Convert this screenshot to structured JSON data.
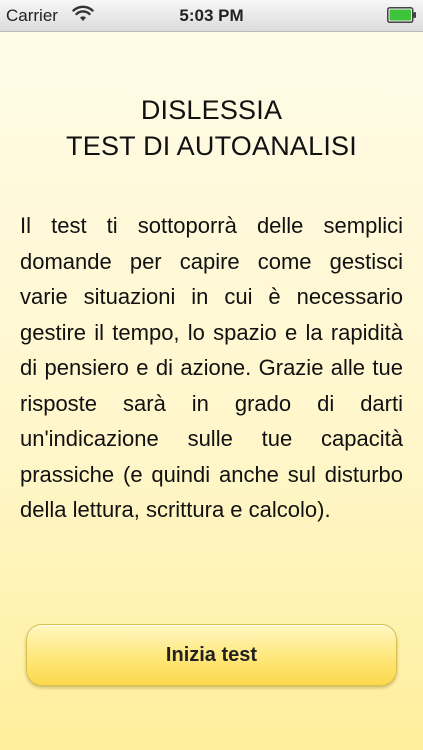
{
  "status_bar": {
    "carrier": "Carrier",
    "time": "5:03 PM",
    "wifi_icon": "wifi-icon",
    "battery_icon": "battery-icon",
    "battery_color": "#3ec43b"
  },
  "main": {
    "title_line1": "DISLESSIA",
    "title_line2": "TEST DI AUTOANALISI",
    "description": "Il test ti sottoporrà delle semplici domande per capire come gestisci varie situazioni in cui è necessario gestire il tempo, lo spazio e la rapidità di pensiero e di azione. Grazie alle tue risposte sarà in grado di darti un'indicazione sulle tue capacità prassiche (e quindi anche sul disturbo della lettura, scrittura e calcolo).",
    "start_button_label": "Inizia test"
  },
  "colors": {
    "background": "#fff6c9",
    "button": "#ffe77a"
  }
}
